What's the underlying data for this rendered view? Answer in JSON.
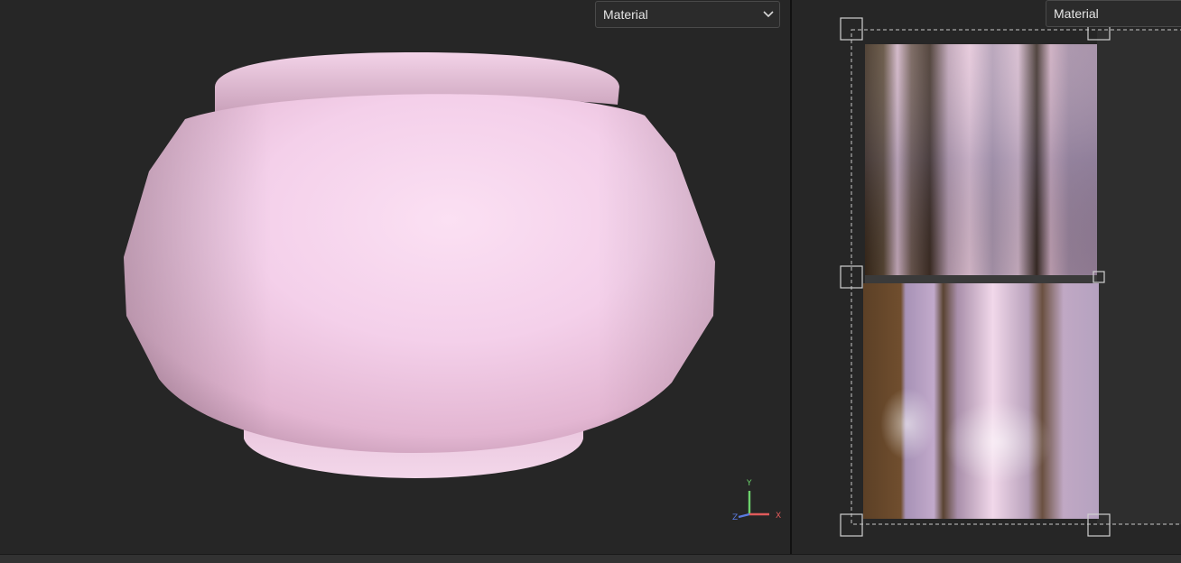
{
  "viewport": {
    "material_dropdown": {
      "label": "Material"
    },
    "gizmo": {
      "y": "Y",
      "x": "X",
      "z": "Z"
    }
  },
  "uv_view": {
    "material_dropdown": {
      "label": "Material"
    }
  },
  "colors": {
    "background": "#262626",
    "pot_pink": "#f6d6ec",
    "axis_x": "#e05a5a",
    "axis_y": "#6cd16c",
    "axis_z": "#5a7ae0"
  },
  "icons": {
    "dropdown_chevron": "chevron-down-icon"
  }
}
